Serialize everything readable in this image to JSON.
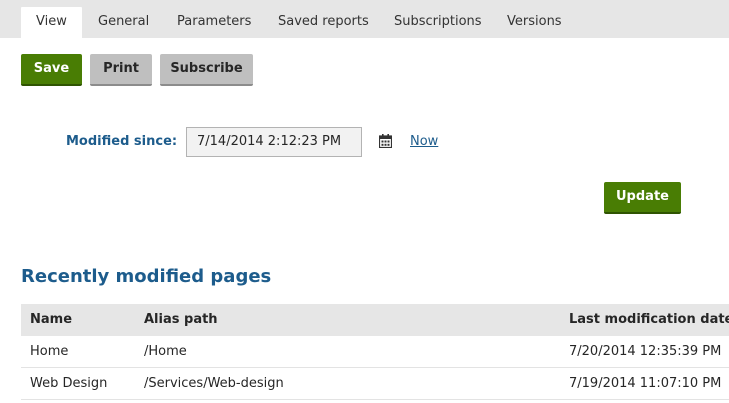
{
  "tabs": [
    {
      "label": "View",
      "active": true
    },
    {
      "label": "General"
    },
    {
      "label": "Parameters"
    },
    {
      "label": "Saved reports"
    },
    {
      "label": "Subscriptions"
    },
    {
      "label": "Versions"
    }
  ],
  "toolbar": {
    "save_label": "Save",
    "print_label": "Print",
    "subscribe_label": "Subscribe"
  },
  "filter": {
    "label": "Modified since:",
    "value": "7/14/2014 2:12:23 PM",
    "calendar_icon": "calendar-icon",
    "now_label": "Now",
    "update_label": "Update"
  },
  "report": {
    "title": "Recently modified pages",
    "columns": [
      "Name",
      "Alias path",
      "Last modification date"
    ],
    "rows": [
      {
        "name": "Home",
        "alias": "/Home",
        "date": "7/20/2014 12:35:39 PM"
      },
      {
        "name": "Web Design",
        "alias": "/Services/Web-design",
        "date": "7/19/2014 11:07:10 PM"
      }
    ]
  },
  "colors": {
    "primary_green": "#497d04",
    "link_blue": "#1d5c8c",
    "header_gray": "#e6e6e6"
  }
}
